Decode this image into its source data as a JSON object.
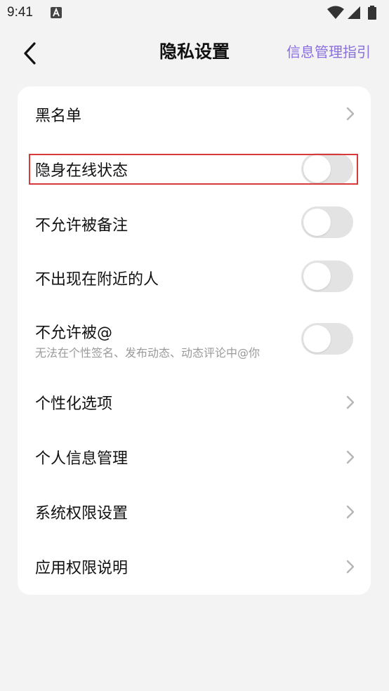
{
  "status_bar": {
    "time": "9:41",
    "icons": [
      "a-notification-icon",
      "wifi-icon",
      "signal-icon",
      "battery-icon"
    ]
  },
  "nav": {
    "title": "隐私设置",
    "right_link": "信息管理指引",
    "accent_color": "#8a6fe0"
  },
  "settings": {
    "blacklist": {
      "label": "黑名单"
    },
    "invisible": {
      "label": "隐身在线状态",
      "enabled": false
    },
    "no_remark": {
      "label": "不允许被备注",
      "enabled": false
    },
    "no_nearby": {
      "label": "不出现在附近的人",
      "enabled": false
    },
    "no_mention": {
      "label": "不允许被@",
      "sub": "无法在个性签名、发布动态、动态评论中@你",
      "enabled": false
    },
    "personalize": {
      "label": "个性化选项"
    },
    "personal_info": {
      "label": "个人信息管理"
    },
    "system_perm": {
      "label": "系统权限设置"
    },
    "app_perm": {
      "label": "应用权限说明"
    }
  },
  "highlight_color": "#d63a3a"
}
